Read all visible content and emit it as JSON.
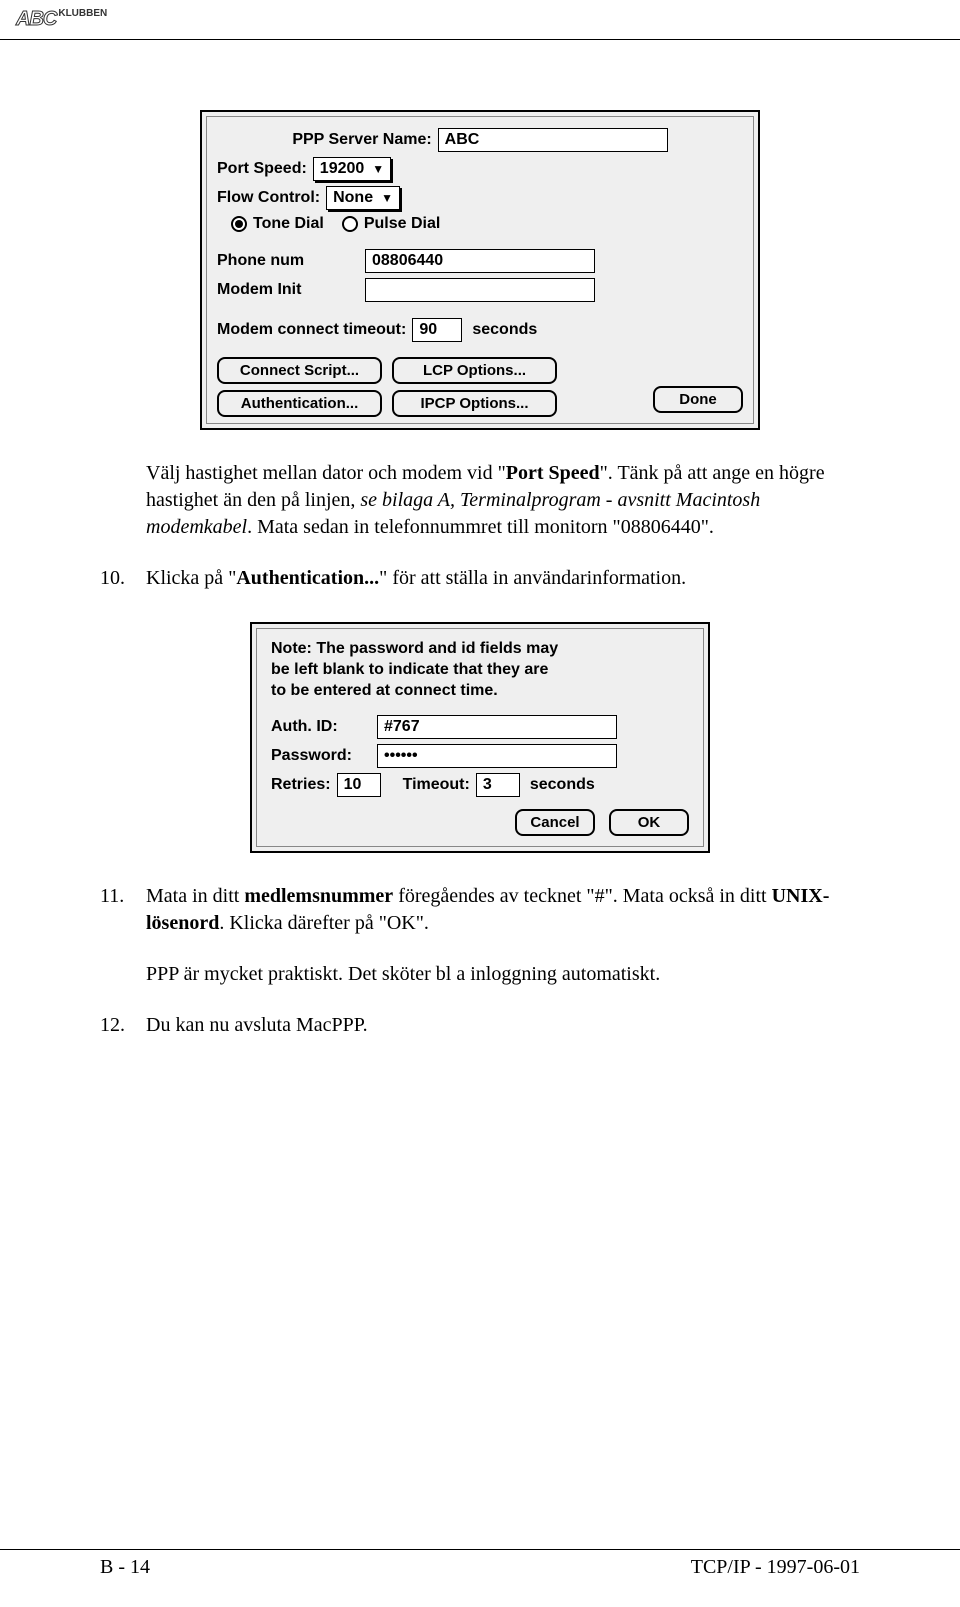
{
  "header": {
    "logo_text": "ABC",
    "logo_suffix": "KLUBBEN"
  },
  "dialog1": {
    "ppp_server_label": "PPP Server Name:",
    "ppp_server_value": "ABC",
    "port_speed_label": "Port Speed:",
    "port_speed_value": "19200",
    "flow_control_label": "Flow Control:",
    "flow_control_value": "None",
    "tone_dial": "Tone Dial",
    "pulse_dial": "Pulse Dial",
    "phone_num_label": "Phone num",
    "phone_num_value": "08806440",
    "modem_init_label": "Modem Init",
    "modem_init_value": "",
    "timeout_label": "Modem connect timeout:",
    "timeout_value": "90",
    "timeout_unit": "seconds",
    "buttons": {
      "connect_script": "Connect Script...",
      "lcp": "LCP Options...",
      "auth": "Authentication...",
      "ipcp": "IPCP Options...",
      "done": "Done"
    }
  },
  "para1": {
    "pre": "Välj hastighet mellan dator och modem vid \"",
    "bold1": "Port Speed",
    "mid1": "\". Tänk på att ange en högre hastighet än den på linjen, ",
    "italic1": "se bilaga A, Terminalprogram - avsnitt Macintosh modemkabel",
    "mid2": ". Mata sedan in telefonnummret till monitorn \"08806440\"."
  },
  "item10": {
    "num": "10.",
    "pre": "Klicka på \"",
    "bold": "Authentication...",
    "post": "\" för att ställa in användarinformation."
  },
  "dialog2": {
    "note_line1": "Note: The password and id fields may",
    "note_line2": "be left blank to indicate that they are",
    "note_line3": "to be entered at connect time.",
    "auth_id_label": "Auth. ID:",
    "auth_id_value": "#767",
    "password_label": "Password:",
    "password_value": "••••••",
    "retries_label": "Retries:",
    "retries_value": "10",
    "timeout_label": "Timeout:",
    "timeout_value": "3",
    "timeout_unit": "seconds",
    "cancel": "Cancel",
    "ok": "OK"
  },
  "item11": {
    "num": "11.",
    "pre": "Mata in ditt ",
    "bold1": "medlemsnummer",
    "mid1": " föregåendes av tecknet \"#\". Mata också in ditt ",
    "bold2": "UNIX-lösenord",
    "post": ". Klicka därefter på \"OK\"."
  },
  "para2": "PPP är mycket praktiskt. Det sköter bl a inloggning automatiskt.",
  "item12": {
    "num": "12.",
    "text": "Du kan nu avsluta MacPPP."
  },
  "footer": {
    "left": "B - 14",
    "right": "TCP/IP - 1997-06-01"
  }
}
